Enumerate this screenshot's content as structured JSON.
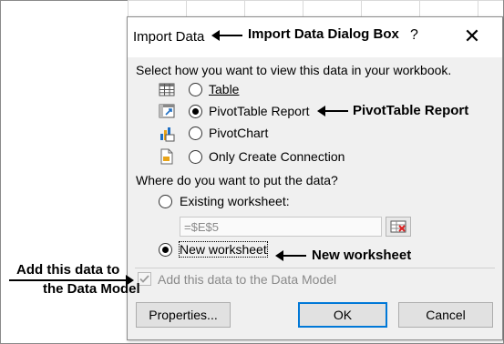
{
  "dialog": {
    "title": "Import Data",
    "help_label": "?",
    "close_label": "✕",
    "view_prompt": "Select how you want to view this data in your workbook.",
    "view_options": [
      {
        "label": "Table",
        "icon": "table-icon",
        "selected": false
      },
      {
        "label": "PivotTable Report",
        "icon": "pivottable-icon",
        "selected": true
      },
      {
        "label": "PivotChart",
        "icon": "pivotchart-icon",
        "selected": false
      },
      {
        "label": "Only Create Connection",
        "icon": "connection-icon",
        "selected": false
      }
    ],
    "put_prompt": "Where do you want to put the data?",
    "existing_label": "Existing worksheet:",
    "range_value": "=$E$5",
    "new_label": "New worksheet",
    "add_model_label": "Add this data to the Data Model",
    "properties_button": "Properties...",
    "ok_button": "OK",
    "cancel_button": "Cancel"
  },
  "annotations": {
    "dialog_box": "Import Data Dialog Box",
    "pivottable": "PivotTable Report",
    "new_worksheet": "New worksheet",
    "data_model_line1": "Add this data to",
    "data_model_line2": "the Data Model"
  },
  "colors": {
    "dialog_bg": "#f0f0f0",
    "titlebar_bg": "#ffffff",
    "ok_border": "#0078d7",
    "disabled_text": "#8a8a8a"
  }
}
